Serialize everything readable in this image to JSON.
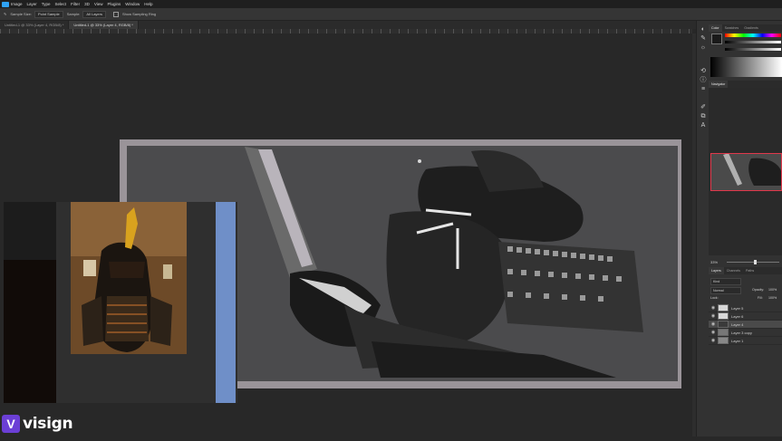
{
  "menubar": {
    "items": [
      "Image",
      "Layer",
      "Type",
      "Select",
      "Filter",
      "3D",
      "View",
      "Plugins",
      "Window",
      "Help"
    ]
  },
  "options": {
    "sample_label": "Sample Size:",
    "sample_value": "Point Sample",
    "sample2_label": "Sample:",
    "sample2_value": "All Layers",
    "ring_label": "Show Sampling Ring"
  },
  "tabs": [
    {
      "label": "Untitled-1 @ 33% (Layer 4, RGB/8) *",
      "active": true
    },
    {
      "label": "Untitled-1 @ 33% (Layer 4, RGB/8) *",
      "active": false
    }
  ],
  "panels": {
    "color_tabs": [
      "Color",
      "Swatches",
      "Gradients"
    ],
    "navigator_tab": "Navigator",
    "zoom": "33%",
    "layers_tabs": [
      "Layers",
      "Channels",
      "Paths"
    ],
    "blend_mode": "Normal",
    "opacity_label": "Opacity:",
    "opacity_value": "100%",
    "fill_label": "Fill:",
    "fill_value": "100%",
    "lock_label": "Lock:",
    "kind_label": "Kind",
    "layers": [
      {
        "name": "Layer 5",
        "selected": false
      },
      {
        "name": "Layer 6",
        "selected": false
      },
      {
        "name": "Layer 4",
        "selected": true
      },
      {
        "name": "Layer 3 copy",
        "selected": false
      },
      {
        "name": "Layer 1",
        "selected": false
      }
    ]
  },
  "watermark": {
    "text": "visign"
  },
  "colors": {
    "accent": "#2fa3f7",
    "brand": "#6b3fd6",
    "canvas_frame": "#9a9499",
    "selected_layer": "#4a4a4a"
  }
}
